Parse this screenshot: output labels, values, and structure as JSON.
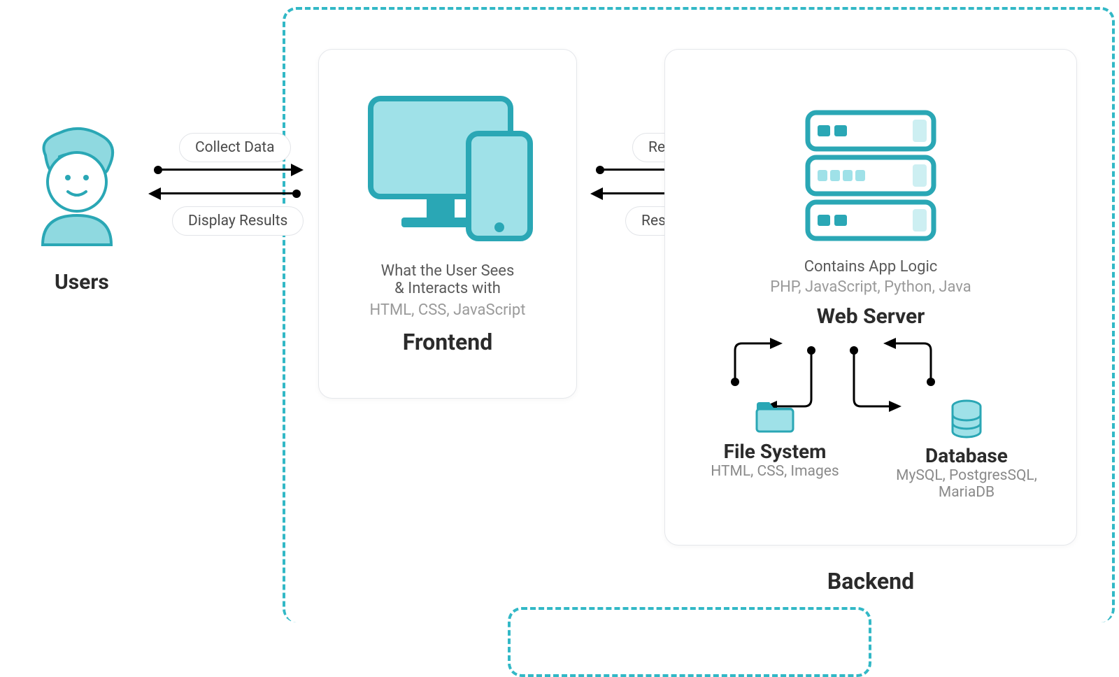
{
  "colors": {
    "accent": "#32b8c6"
  },
  "users": {
    "label": "Users"
  },
  "arrows": {
    "user_to_frontend": "Collect Data",
    "frontend_to_user": "Display Results",
    "frontend_to_backend": "Request",
    "backend_to_frontend": "Response"
  },
  "frontend": {
    "desc1": "What the User Sees",
    "desc2": "& Interacts with",
    "tech": "HTML, CSS, JavaScript",
    "title": "Frontend"
  },
  "backend": {
    "desc1": "Contains App Logic",
    "tech": "PHP, JavaScript, Python, Java",
    "web_server": "Web Server",
    "file_system": {
      "title": "File System",
      "desc": "HTML, CSS, Images"
    },
    "database": {
      "title": "Database",
      "desc": "MySQL, PostgresSQL, MariaDB"
    },
    "title": "Backend"
  }
}
